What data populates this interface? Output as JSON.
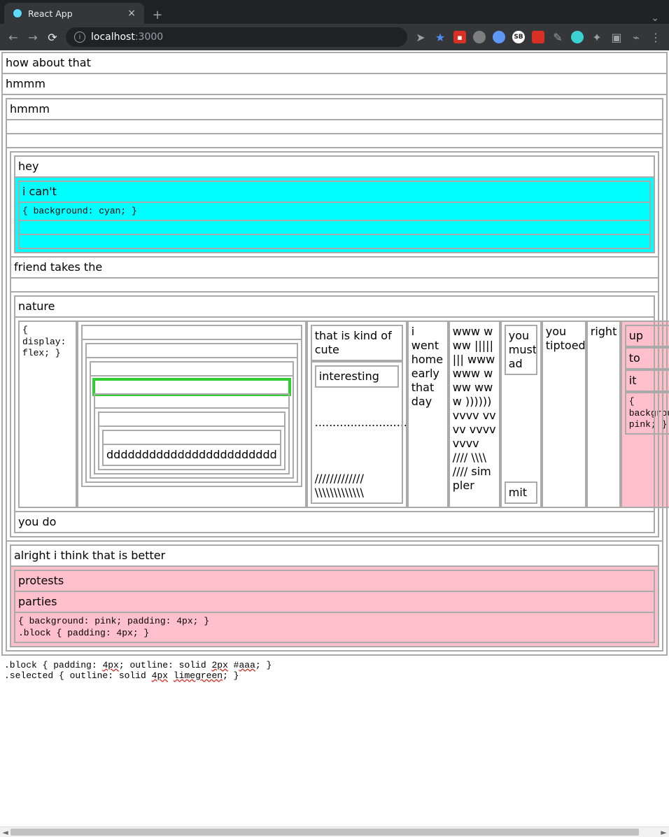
{
  "chrome": {
    "tab_title": "React App",
    "url_host": "localhost",
    "url_port": ":3000"
  },
  "top": {
    "l1": "how about that",
    "l2": "hmmm",
    "l3": "hmmm"
  },
  "cyan": {
    "header": "hey",
    "line1": "i can't",
    "rule": "{ background: cyan; }"
  },
  "mid": {
    "friend": "friend takes the",
    "nature": "nature",
    "you_do": "you do"
  },
  "flex": {
    "rule": "{ display: flex; }",
    "deep_text": "dddddddddddddddddddddddd",
    "col3": {
      "a": "that is kind of cute",
      "b": "interesting",
      "dots": "............................",
      "sl1": "/////////////",
      "sl2": "\\\\\\\\\\\\\\\\\\\\\\\\\\"
    },
    "col4": "i went home early that day",
    "col5": "www www |||||||| www www www www )))))) vvvv vvvv vvvv vvvv //// \\\\\\\\ //// simpler",
    "col6a": "you must ad",
    "col6b": "mit",
    "col7": "you tiptoed",
    "col8": "right",
    "pink": {
      "a": "up",
      "b": "to",
      "c": "it",
      "rule": "{ background: pink; }"
    }
  },
  "bottom": {
    "alright": "alright i think that is better",
    "protests": "protests",
    "parties": "parties",
    "pink_rule": "{ background: pink; padding: 4px; }\n.block { padding: 4px; }"
  },
  "footer": {
    "line1_a": ".block { padding: ",
    "line1_b": "4px",
    "line1_c": "; outline: solid ",
    "line1_d": "2px",
    "line1_e": " #",
    "line1_f": "aaa",
    "line1_g": "; }",
    "line2_a": ".selected { outline: solid ",
    "line2_b": "4px",
    "line2_c": " ",
    "line2_d": "limegreen",
    "line2_e": "; }"
  }
}
